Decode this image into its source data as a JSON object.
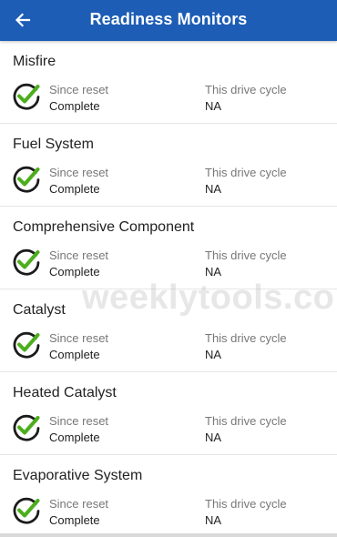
{
  "header": {
    "title": "Readiness Monitors",
    "back_icon": "arrow-left-icon"
  },
  "colors": {
    "app_bar": "#1d5db5",
    "check_green": "#4cae1d",
    "check_ring": "#1b1b1b"
  },
  "monitors": [
    {
      "name": "Misfire",
      "since_label": "Since reset",
      "since_value": "Complete",
      "drive_label": "This drive cycle",
      "drive_value": "NA",
      "icon": "check-circle-icon"
    },
    {
      "name": "Fuel System",
      "since_label": "Since reset",
      "since_value": "Complete",
      "drive_label": "This drive cycle",
      "drive_value": "NA",
      "icon": "check-circle-icon"
    },
    {
      "name": "Comprehensive Component",
      "since_label": "Since reset",
      "since_value": "Complete",
      "drive_label": "This drive cycle",
      "drive_value": "NA",
      "icon": "check-circle-icon"
    },
    {
      "name": "Catalyst",
      "since_label": "Since reset",
      "since_value": "Complete",
      "drive_label": "This drive cycle",
      "drive_value": "NA",
      "icon": "check-circle-icon"
    },
    {
      "name": "Heated Catalyst",
      "since_label": "Since reset",
      "since_value": "Complete",
      "drive_label": "This drive cycle",
      "drive_value": "NA",
      "icon": "check-circle-icon"
    },
    {
      "name": "Evaporative System",
      "since_label": "Since reset",
      "since_value": "Complete",
      "drive_label": "This drive cycle",
      "drive_value": "NA",
      "icon": "check-circle-icon"
    }
  ],
  "watermark": "weeklytools.com"
}
